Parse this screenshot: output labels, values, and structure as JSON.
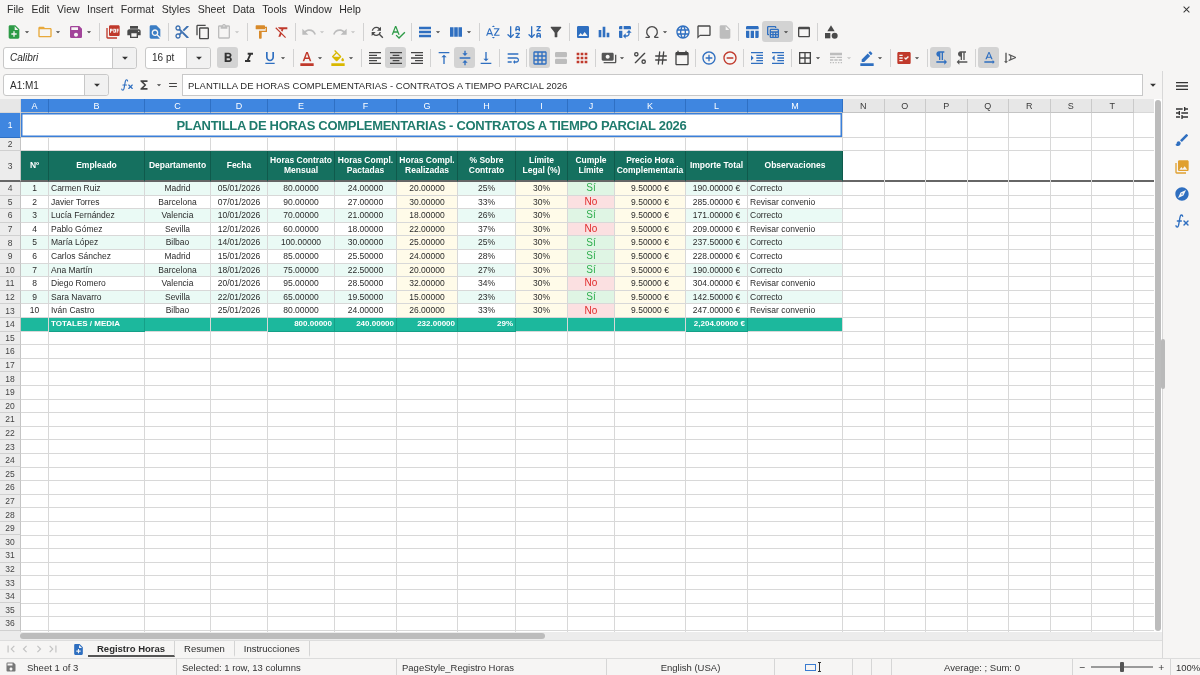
{
  "menu": [
    "File",
    "Edit",
    "View",
    "Insert",
    "Format",
    "Styles",
    "Sheet",
    "Data",
    "Tools",
    "Window",
    "Help"
  ],
  "standard_toolbar": [
    {
      "active": false,
      "disabled": false
    },
    {
      "active": false,
      "disabled": false
    },
    {
      "active": false,
      "disabled": false
    },
    {
      "active": false,
      "disabled": false
    },
    {
      "active": false,
      "disabled": false
    },
    {
      "active": false,
      "disabled": false
    },
    {
      "active": false,
      "disabled": false
    },
    {
      "active": false,
      "disabled": false
    },
    {
      "active": false,
      "disabled": true
    },
    {
      "active": false,
      "disabled": false
    },
    {
      "active": false,
      "disabled": false
    },
    {
      "active": false,
      "disabled": true
    },
    {
      "active": false,
      "disabled": true
    },
    {
      "active": false,
      "disabled": false
    },
    {
      "active": false,
      "disabled": false
    },
    {
      "active": false,
      "disabled": false
    },
    {
      "active": false,
      "disabled": false
    },
    {
      "active": false,
      "disabled": false
    },
    {
      "active": false,
      "disabled": false
    },
    {
      "active": false,
      "disabled": false
    },
    {
      "active": false,
      "disabled": false
    },
    {
      "active": false,
      "disabled": false
    },
    {
      "active": false,
      "disabled": false
    },
    {
      "active": false,
      "disabled": false
    },
    {
      "active": false,
      "disabled": false
    },
    {
      "active": false,
      "disabled": false
    },
    {
      "active": false,
      "disabled": false
    },
    {
      "active": false,
      "disabled": true
    },
    {
      "active": false,
      "disabled": false
    },
    {
      "active": true,
      "disabled": false
    },
    {
      "active": false,
      "disabled": false
    },
    {
      "active": false,
      "disabled": false
    }
  ],
  "formatting_toolbar": {
    "font_name": "Calibri",
    "font_size": "16 pt",
    "buttons": [
      {
        "active": true,
        "disabled": false
      },
      {
        "active": false,
        "disabled": false
      },
      {
        "active": false,
        "disabled": false
      },
      {
        "active": false,
        "disabled": false
      },
      {
        "active": false,
        "disabled": false
      },
      {
        "active": false,
        "disabled": false
      },
      {
        "active": true,
        "disabled": false
      },
      {
        "active": false,
        "disabled": false
      },
      {
        "active": false,
        "disabled": false
      },
      {
        "active": true,
        "disabled": false
      },
      {
        "active": false,
        "disabled": false
      },
      {
        "active": false,
        "disabled": false
      },
      {
        "active": true,
        "disabled": false
      },
      {
        "active": false,
        "disabled": true
      },
      {
        "active": false,
        "disabled": false
      },
      {
        "active": false,
        "disabled": false
      },
      {
        "active": false,
        "disabled": false
      },
      {
        "active": false,
        "disabled": false
      },
      {
        "active": false,
        "disabled": false
      },
      {
        "active": false,
        "disabled": false
      },
      {
        "active": false,
        "disabled": false
      },
      {
        "active": false,
        "disabled": false
      },
      {
        "active": false,
        "disabled": false
      },
      {
        "active": false,
        "disabled": false
      },
      {
        "active": false,
        "disabled": true
      },
      {
        "active": false,
        "disabled": false
      },
      {
        "active": false,
        "disabled": false
      },
      {
        "active": true,
        "disabled": false
      },
      {
        "active": false,
        "disabled": false
      },
      {
        "active": true,
        "disabled": false
      },
      {
        "active": false,
        "disabled": false
      }
    ]
  },
  "formula_bar": {
    "name_box": "A1:M1",
    "formula": "PLANTILLA DE HORAS COMPLEMENTARIAS - CONTRATOS A TIEMPO PARCIAL 2026"
  },
  "sheet": {
    "columns": [
      {
        "label": "A",
        "selected": true
      },
      {
        "label": "B",
        "selected": true
      },
      {
        "label": "C",
        "selected": true
      },
      {
        "label": "D",
        "selected": true
      },
      {
        "label": "E",
        "selected": true
      },
      {
        "label": "F",
        "selected": true
      },
      {
        "label": "G",
        "selected": true
      },
      {
        "label": "H",
        "selected": true
      },
      {
        "label": "I",
        "selected": true
      },
      {
        "label": "J",
        "selected": true
      },
      {
        "label": "K",
        "selected": true
      },
      {
        "label": "L",
        "selected": true
      },
      {
        "label": "M",
        "selected": true
      },
      {
        "label": "N",
        "selected": false
      },
      {
        "label": "O",
        "selected": false
      },
      {
        "label": "P",
        "selected": false
      },
      {
        "label": "Q",
        "selected": false
      },
      {
        "label": "R",
        "selected": false
      },
      {
        "label": "S",
        "selected": false
      },
      {
        "label": "T",
        "selected": false
      }
    ],
    "rows": [
      {
        "label": "1",
        "selected": true
      },
      {
        "label": "2",
        "selected": false
      },
      {
        "label": "3",
        "selected": false
      },
      {
        "label": "4",
        "selected": false
      },
      {
        "label": "5",
        "selected": false
      },
      {
        "label": "6",
        "selected": false
      },
      {
        "label": "7",
        "selected": false
      },
      {
        "label": "8",
        "selected": false
      },
      {
        "label": "9",
        "selected": false
      },
      {
        "label": "10",
        "selected": false
      },
      {
        "label": "11",
        "selected": false
      },
      {
        "label": "12",
        "selected": false
      },
      {
        "label": "13",
        "selected": false
      },
      {
        "label": "14",
        "selected": false
      },
      {
        "label": "15",
        "selected": false
      },
      {
        "label": "16",
        "selected": false
      },
      {
        "label": "17",
        "selected": false
      },
      {
        "label": "18",
        "selected": false
      },
      {
        "label": "19",
        "selected": false
      },
      {
        "label": "20",
        "selected": false
      },
      {
        "label": "21",
        "selected": false
      },
      {
        "label": "22",
        "selected": false
      },
      {
        "label": "23",
        "selected": false
      },
      {
        "label": "24",
        "selected": false
      },
      {
        "label": "25",
        "selected": false
      },
      {
        "label": "26",
        "selected": false
      },
      {
        "label": "27",
        "selected": false
      },
      {
        "label": "28",
        "selected": false
      },
      {
        "label": "29",
        "selected": false
      },
      {
        "label": "30",
        "selected": false
      },
      {
        "label": "31",
        "selected": false
      },
      {
        "label": "32",
        "selected": false
      },
      {
        "label": "33",
        "selected": false
      },
      {
        "label": "34",
        "selected": false
      },
      {
        "label": "35",
        "selected": false
      },
      {
        "label": "36",
        "selected": false
      }
    ],
    "title": "PLANTILLA DE HORAS COMPLEMENTARIAS - CONTRATOS A TIEMPO PARCIAL 2026",
    "headers": [
      "Nº",
      "Empleado",
      "Departamento",
      "Fecha",
      "Horas Contrato Mensual",
      "Horas Compl. Pactadas",
      "Horas Compl. Realizadas",
      "% Sobre Contrato",
      "Límite Legal (%)",
      "Cumple Límite",
      "Precio Hora Complementaria",
      "Importe Total",
      "Observaciones"
    ],
    "data": [
      {
        "cells": [
          "1",
          "Carmen Ruiz",
          "Madrid",
          "05/01/2026",
          "80.00000",
          "24.00000",
          "20.00000",
          "25%",
          "30%",
          "Sí",
          "9.50000 €",
          "190.00000 €",
          "Correcto"
        ],
        "complies": true
      },
      {
        "cells": [
          "2",
          "Javier Torres",
          "Barcelona",
          "07/01/2026",
          "90.00000",
          "27.00000",
          "30.00000",
          "33%",
          "30%",
          "No",
          "9.50000 €",
          "285.00000 €",
          "Revisar convenio"
        ],
        "complies": false
      },
      {
        "cells": [
          "3",
          "Lucía Fernández",
          "Valencia",
          "10/01/2026",
          "70.00000",
          "21.00000",
          "18.00000",
          "26%",
          "30%",
          "Sí",
          "9.50000 €",
          "171.00000 €",
          "Correcto"
        ],
        "complies": true
      },
      {
        "cells": [
          "4",
          "Pablo Gómez",
          "Sevilla",
          "12/01/2026",
          "60.00000",
          "18.00000",
          "22.00000",
          "37%",
          "30%",
          "No",
          "9.50000 €",
          "209.00000 €",
          "Revisar convenio"
        ],
        "complies": false
      },
      {
        "cells": [
          "5",
          "María López",
          "Bilbao",
          "14/01/2026",
          "100.00000",
          "30.00000",
          "25.00000",
          "25%",
          "30%",
          "Sí",
          "9.50000 €",
          "237.50000 €",
          "Correcto"
        ],
        "complies": true
      },
      {
        "cells": [
          "6",
          "Carlos Sánchez",
          "Madrid",
          "15/01/2026",
          "85.00000",
          "25.50000",
          "24.00000",
          "28%",
          "30%",
          "Sí",
          "9.50000 €",
          "228.00000 €",
          "Correcto"
        ],
        "complies": true
      },
      {
        "cells": [
          "7",
          "Ana Martín",
          "Barcelona",
          "18/01/2026",
          "75.00000",
          "22.50000",
          "20.00000",
          "27%",
          "30%",
          "Sí",
          "9.50000 €",
          "190.00000 €",
          "Correcto"
        ],
        "complies": true
      },
      {
        "cells": [
          "8",
          "Diego Romero",
          "Valencia",
          "20/01/2026",
          "95.00000",
          "28.50000",
          "32.00000",
          "34%",
          "30%",
          "No",
          "9.50000 €",
          "304.00000 €",
          "Revisar convenio"
        ],
        "complies": false
      },
      {
        "cells": [
          "9",
          "Sara Navarro",
          "Sevilla",
          "22/01/2026",
          "65.00000",
          "19.50000",
          "15.00000",
          "23%",
          "30%",
          "Sí",
          "9.50000 €",
          "142.50000 €",
          "Correcto"
        ],
        "complies": true
      },
      {
        "cells": [
          "10",
          "Iván Castro",
          "Bilbao",
          "25/01/2026",
          "80.00000",
          "24.00000",
          "26.00000",
          "33%",
          "30%",
          "No",
          "9.50000 €",
          "247.00000 €",
          "Revisar convenio"
        ],
        "complies": false
      }
    ],
    "totals": {
      "label": "TOTALES / MEDIA",
      "contract_hours": "800.00000",
      "agreed_hours": "240.00000",
      "worked_hours": "232.00000",
      "percent": "29%",
      "amount": "2,204.00000 €"
    }
  },
  "sheet_navigation": {
    "disabled": true
  },
  "sheet_tabs": [
    {
      "label": "Registro Horas",
      "selected": true
    },
    {
      "label": "Resumen",
      "selected": false
    },
    {
      "label": "Instrucciones",
      "selected": false
    }
  ],
  "status_bar": {
    "sheet": "Sheet 1 of 3",
    "selection": "Selected: 1 row, 13 columns",
    "page_style": "PageStyle_Registro Horas",
    "language": "English (USA)",
    "summary": "Average: ; Sum: 0",
    "zoom_slider": {
      "level": 0.5
    },
    "zoom": "100%"
  }
}
